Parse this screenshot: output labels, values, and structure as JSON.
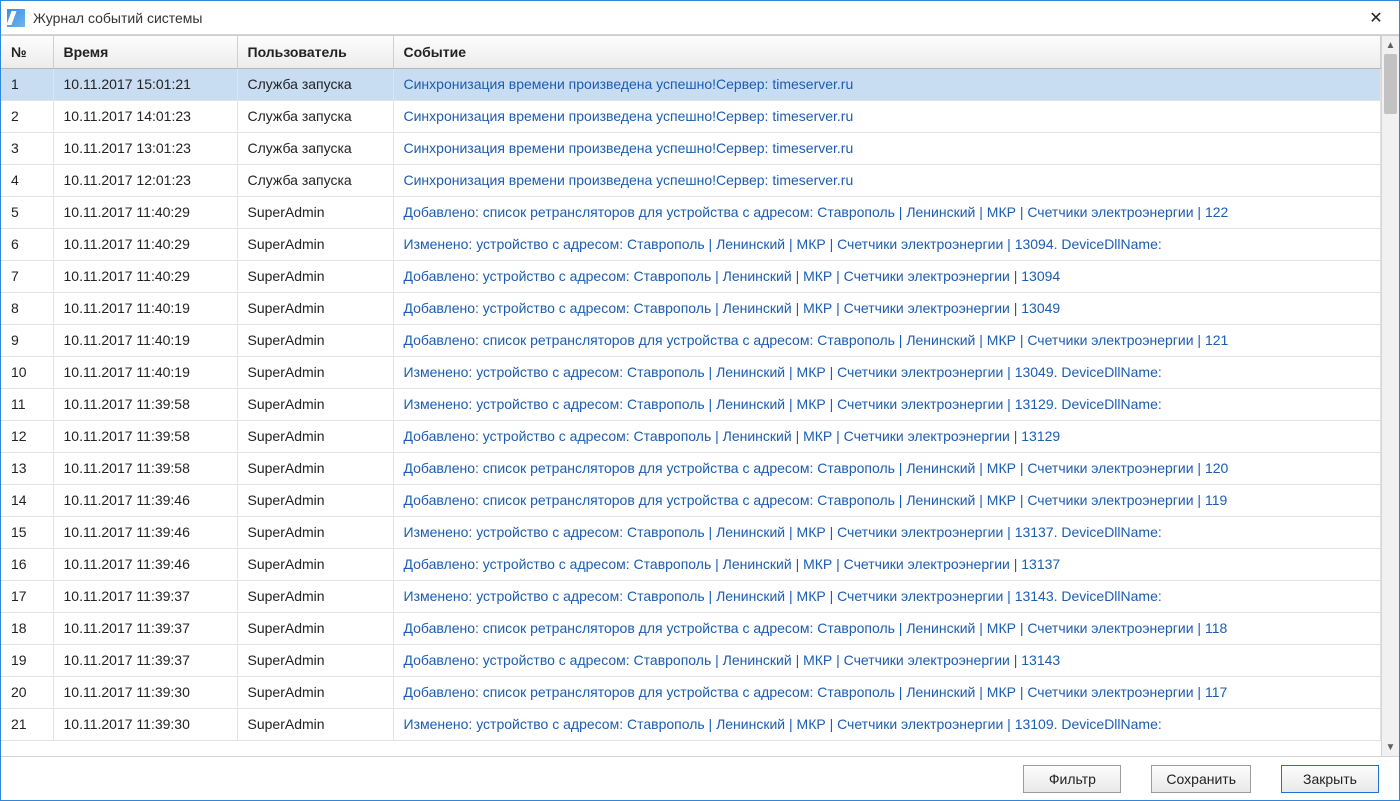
{
  "window": {
    "title": "Журнал событий системы"
  },
  "columns": {
    "num": "№",
    "time": "Время",
    "user": "Пользователь",
    "event": "Событие"
  },
  "rows": [
    {
      "num": "1",
      "time": "10.11.2017 15:01:21",
      "user": "Служба запуска",
      "event": "Синхронизация времени произведена успешно!Сервер: timeserver.ru",
      "selected": true
    },
    {
      "num": "2",
      "time": "10.11.2017 14:01:23",
      "user": "Служба запуска",
      "event": "Синхронизация времени произведена успешно!Сервер: timeserver.ru"
    },
    {
      "num": "3",
      "time": "10.11.2017 13:01:23",
      "user": "Служба запуска",
      "event": "Синхронизация времени произведена успешно!Сервер: timeserver.ru"
    },
    {
      "num": "4",
      "time": "10.11.2017 12:01:23",
      "user": "Служба запуска",
      "event": "Синхронизация времени произведена успешно!Сервер: timeserver.ru"
    },
    {
      "num": "5",
      "time": "10.11.2017 11:40:29",
      "user": "SuperAdmin",
      "event": "Добавлено: список ретрансляторов для устройства с адресом: Ставрополь | Ленинский | МКР | Счетчики электроэнергии | 122"
    },
    {
      "num": "6",
      "time": "10.11.2017 11:40:29",
      "user": "SuperAdmin",
      "event": "Изменено: устройство с адресом: Ставрополь | Ленинский | МКР | Счетчики электроэнергии | 13094. DeviceDllName:"
    },
    {
      "num": "7",
      "time": "10.11.2017 11:40:29",
      "user": "SuperAdmin",
      "event": "Добавлено: устройство с адресом: Ставрополь | Ленинский | МКР | Счетчики электроэнергии | 13094"
    },
    {
      "num": "8",
      "time": "10.11.2017 11:40:19",
      "user": "SuperAdmin",
      "event": "Добавлено: устройство с адресом: Ставрополь | Ленинский | МКР | Счетчики электроэнергии | 13049"
    },
    {
      "num": "9",
      "time": "10.11.2017 11:40:19",
      "user": "SuperAdmin",
      "event": "Добавлено: список ретрансляторов для устройства с адресом: Ставрополь | Ленинский | МКР | Счетчики электроэнергии | 121"
    },
    {
      "num": "10",
      "time": "10.11.2017 11:40:19",
      "user": "SuperAdmin",
      "event": "Изменено: устройство с адресом: Ставрополь | Ленинский | МКР | Счетчики электроэнергии | 13049. DeviceDllName:"
    },
    {
      "num": "11",
      "time": "10.11.2017 11:39:58",
      "user": "SuperAdmin",
      "event": "Изменено: устройство с адресом: Ставрополь | Ленинский | МКР | Счетчики электроэнергии | 13129. DeviceDllName:"
    },
    {
      "num": "12",
      "time": "10.11.2017 11:39:58",
      "user": "SuperAdmin",
      "event": "Добавлено: устройство с адресом: Ставрополь | Ленинский | МКР | Счетчики электроэнергии | 13129"
    },
    {
      "num": "13",
      "time": "10.11.2017 11:39:58",
      "user": "SuperAdmin",
      "event": "Добавлено: список ретрансляторов для устройства с адресом: Ставрополь | Ленинский | МКР | Счетчики электроэнергии | 120"
    },
    {
      "num": "14",
      "time": "10.11.2017 11:39:46",
      "user": "SuperAdmin",
      "event": "Добавлено: список ретрансляторов для устройства с адресом: Ставрополь | Ленинский | МКР | Счетчики электроэнергии | 119"
    },
    {
      "num": "15",
      "time": "10.11.2017 11:39:46",
      "user": "SuperAdmin",
      "event": "Изменено: устройство с адресом: Ставрополь | Ленинский | МКР | Счетчики электроэнергии | 13137. DeviceDllName:"
    },
    {
      "num": "16",
      "time": "10.11.2017 11:39:46",
      "user": "SuperAdmin",
      "event": "Добавлено: устройство с адресом: Ставрополь | Ленинский | МКР | Счетчики электроэнергии | 13137"
    },
    {
      "num": "17",
      "time": "10.11.2017 11:39:37",
      "user": "SuperAdmin",
      "event": "Изменено: устройство с адресом: Ставрополь | Ленинский | МКР | Счетчики электроэнергии | 13143. DeviceDllName:"
    },
    {
      "num": "18",
      "time": "10.11.2017 11:39:37",
      "user": "SuperAdmin",
      "event": "Добавлено: список ретрансляторов для устройства с адресом: Ставрополь | Ленинский | МКР | Счетчики электроэнергии | 118"
    },
    {
      "num": "19",
      "time": "10.11.2017 11:39:37",
      "user": "SuperAdmin",
      "event": "Добавлено: устройство с адресом: Ставрополь | Ленинский | МКР | Счетчики электроэнергии | 13143"
    },
    {
      "num": "20",
      "time": "10.11.2017 11:39:30",
      "user": "SuperAdmin",
      "event": "Добавлено: список ретрансляторов для устройства с адресом: Ставрополь | Ленинский | МКР | Счетчики электроэнергии | 117"
    },
    {
      "num": "21",
      "time": "10.11.2017 11:39:30",
      "user": "SuperAdmin",
      "event": "Изменено: устройство с адресом: Ставрополь | Ленинский | МКР | Счетчики электроэнергии | 13109. DeviceDllName:"
    }
  ],
  "footer": {
    "filter": "Фильтр",
    "save": "Сохранить",
    "close": "Закрыть"
  }
}
